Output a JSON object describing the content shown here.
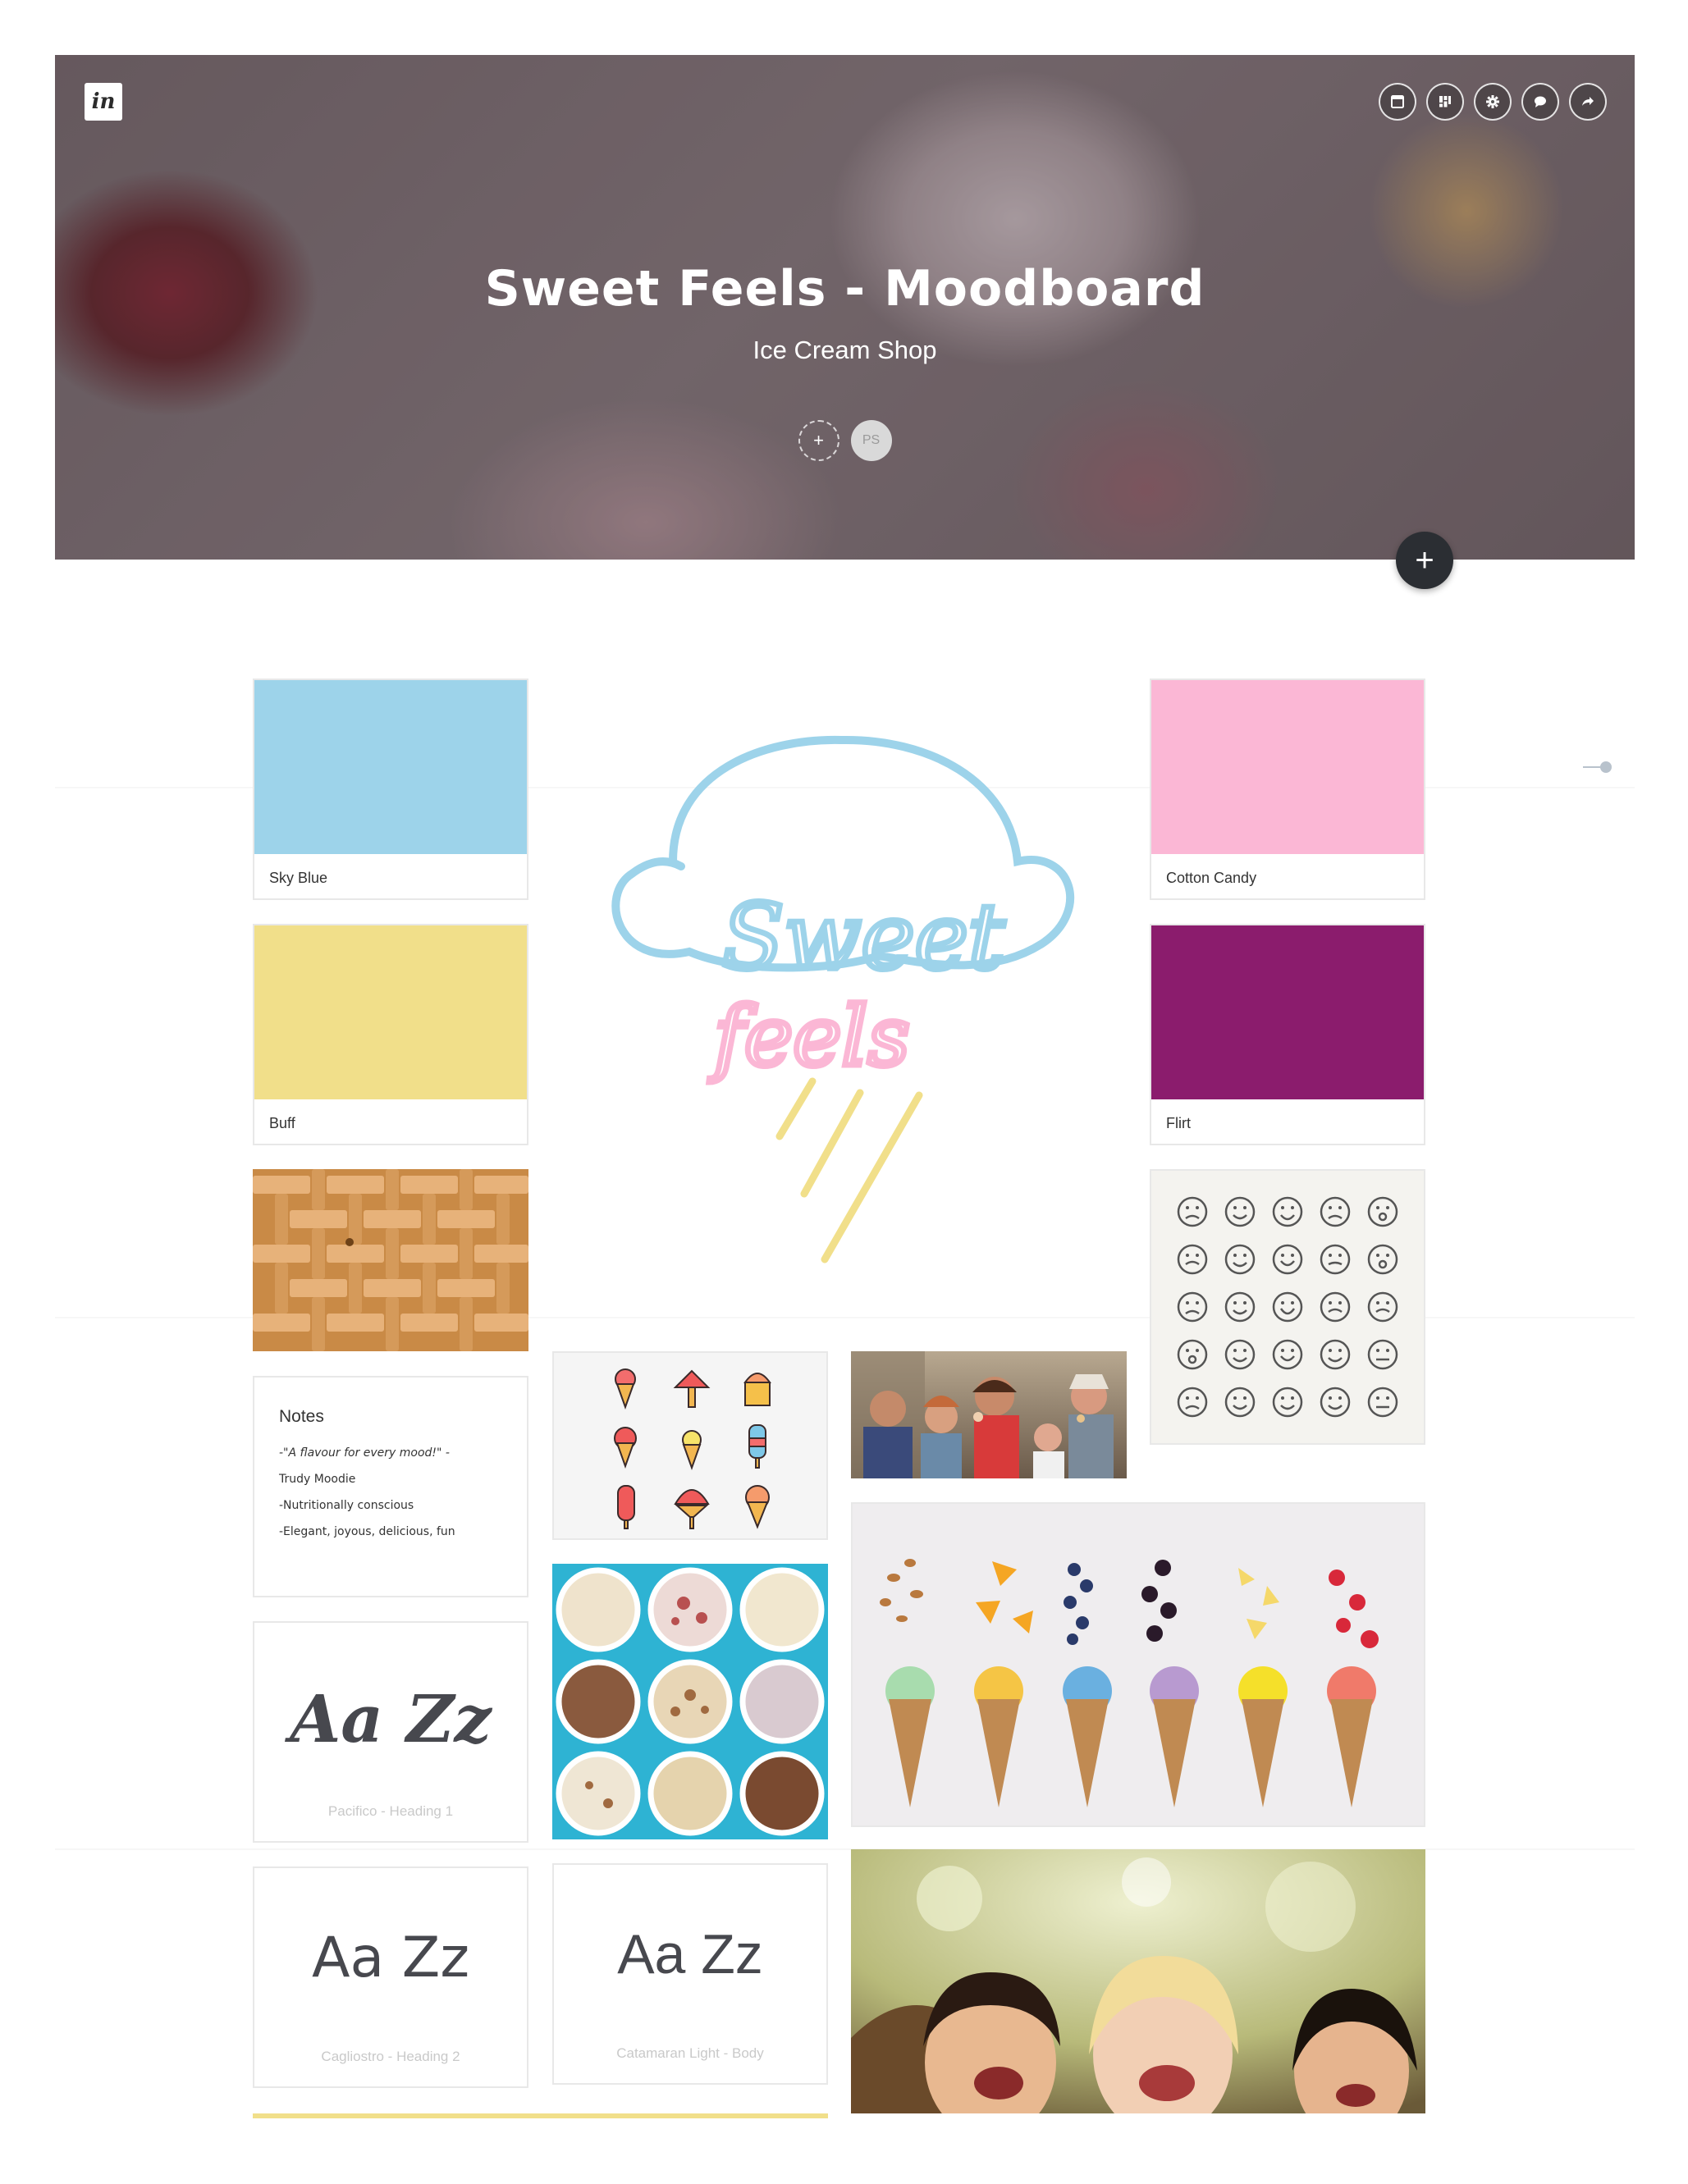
{
  "header": {
    "logo": "in",
    "title": "Sweet Feels - Moodboard",
    "subtitle": "Ice Cream Shop",
    "collaborator_initials": "PS",
    "add_collaborator_label": "+",
    "add_button_label": "+",
    "toolbar_icons": [
      "layout-icon",
      "grid-icon",
      "gear-icon",
      "comment-icon",
      "share-icon"
    ]
  },
  "swatches": [
    {
      "name": "Sky Blue",
      "color": "#9dd3ea"
    },
    {
      "name": "Buff",
      "color": "#f1df8a"
    },
    {
      "name": "Cotton Candy",
      "color": "#fbb7d5"
    },
    {
      "name": "Flirt",
      "color": "#8b1c6d"
    }
  ],
  "notes": {
    "title": "Notes",
    "line1": "-\"A flavour for every mood!\" -",
    "line2": "Trudy Moodie",
    "line3": "-Nutritionally conscious",
    "line4": "-Elegant, joyous, delicious, fun"
  },
  "typography": [
    {
      "sample": "Aa Zz",
      "caption": "Pacifico - Heading 1"
    },
    {
      "sample": "Aa Zz",
      "caption": "Cagliostro - Heading 2"
    },
    {
      "sample": "Aa Zz",
      "caption": "Catamaran Light - Body"
    }
  ],
  "logo_art": {
    "word1": "Sweet",
    "word2": "feels"
  },
  "accent_bar_color": "#f1df8a"
}
